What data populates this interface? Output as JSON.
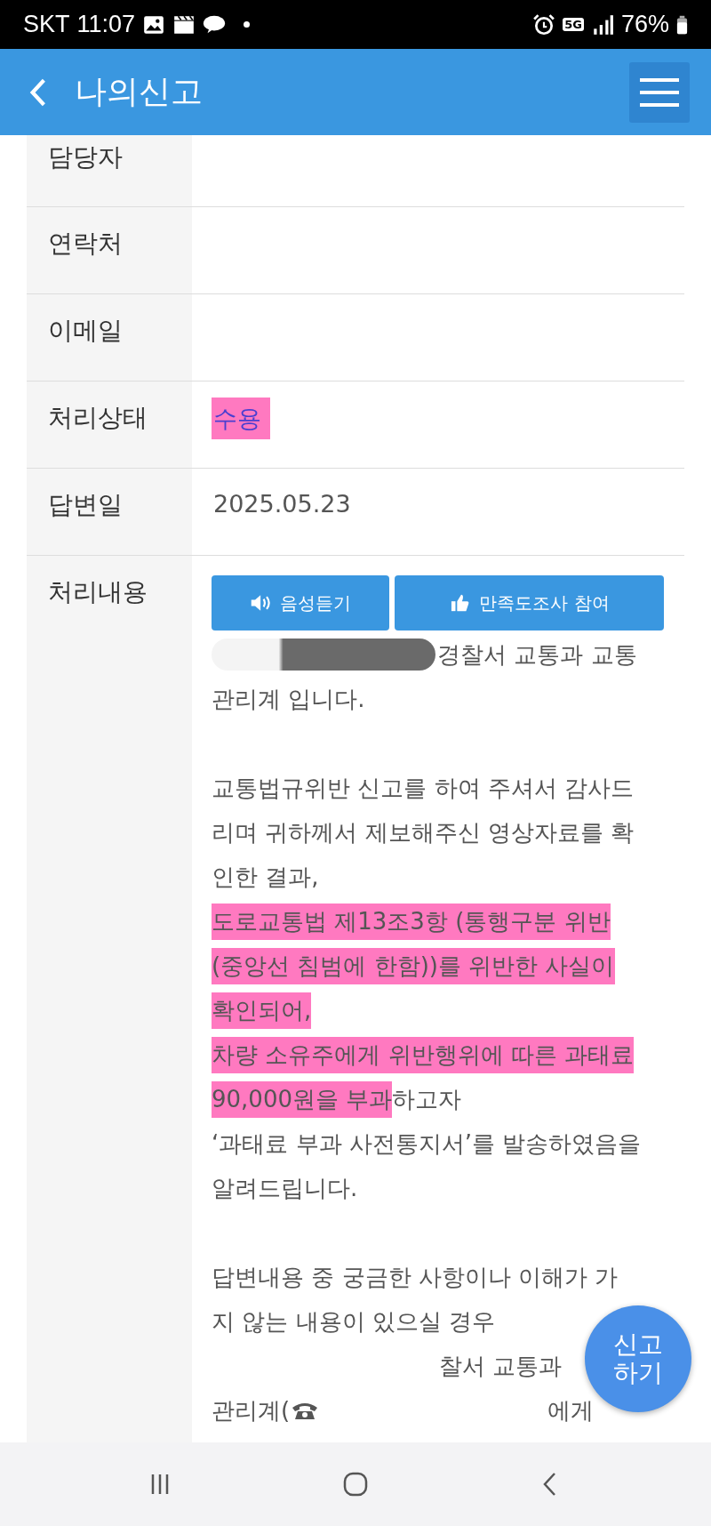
{
  "status_bar": {
    "carrier": "SKT",
    "time": "11:07",
    "network": "5G",
    "battery": "76%"
  },
  "header": {
    "title": "나의신고"
  },
  "fields": [
    {
      "label": "담당자"
    },
    {
      "label": "연락처"
    },
    {
      "label": "이메일"
    },
    {
      "label": "처리상태",
      "value": "수용",
      "highlighted": true
    },
    {
      "label": "답변일",
      "value": "2025.05.23",
      "highlighted": false
    }
  ],
  "content": {
    "label": "처리내용",
    "buttons": [
      {
        "label": "음성듣기",
        "kind": "speaker"
      },
      {
        "label": "만족도조사 참여",
        "kind": "thumb"
      }
    ],
    "paragraphs": [
      [
        [
          {
            "kind": "redacted"
          },
          {
            "kind": "text",
            "text": "경찰서 교통과 교통",
            "highlighted": false
          }
        ],
        [
          {
            "kind": "text",
            "text": "관리계 입니다.",
            "highlighted": false
          }
        ]
      ],
      [
        [
          {
            "kind": "text",
            "text": "교통법규위반 신고를 하여 주셔서 감사드",
            "highlighted": false
          }
        ],
        [
          {
            "kind": "text",
            "text": "리며 귀하께서 제보해주신 영상자료를 확",
            "highlighted": false
          }
        ],
        [
          {
            "kind": "text",
            "text": "인한 결과,",
            "highlighted": false
          }
        ],
        [
          {
            "kind": "text",
            "text": "도로교통법 제13조3항 (통행구분 위반",
            "highlighted": true
          }
        ],
        [
          {
            "kind": "text",
            "text": "(중앙선 침범에 한함))를 위반한 사실이",
            "highlighted": true
          }
        ],
        [
          {
            "kind": "text",
            "text": "확인되어,",
            "highlighted": true
          }
        ],
        [
          {
            "kind": "text",
            "text": "차량 소유주에게 위반행위에 따른 과태료",
            "highlighted": true
          }
        ],
        [
          {
            "kind": "text",
            "text": "90,000원을 부과",
            "highlighted": true
          },
          {
            "kind": "text",
            "text": "하고자",
            "highlighted": false
          }
        ],
        [
          {
            "kind": "text",
            "text": "‘과태료 부과 사전통지서’를 발송하였음을",
            "highlighted": false
          }
        ],
        [
          {
            "kind": "text",
            "text": "알려드립니다.",
            "highlighted": false
          }
        ]
      ],
      [
        [
          {
            "kind": "text",
            "text": "답변내용 중 궁금한 사항이나 이해가 가",
            "highlighted": false
          }
        ],
        [
          {
            "kind": "text",
            "text": "지 않는 내용이 있으실 경우",
            "highlighted": false
          }
        ],
        [
          {
            "kind": "blank"
          },
          {
            "kind": "text",
            "text": "찰서 교통과",
            "highlighted": false
          }
        ],
        [
          {
            "kind": "text",
            "text": "관리계(",
            "highlighted": false
          },
          {
            "kind": "phone"
          },
          {
            "kind": "blank"
          },
          {
            "kind": "text",
            "text": "에게",
            "highlighted": false
          }
        ]
      ]
    ]
  },
  "fab": {
    "label": "신고\n하기"
  }
}
